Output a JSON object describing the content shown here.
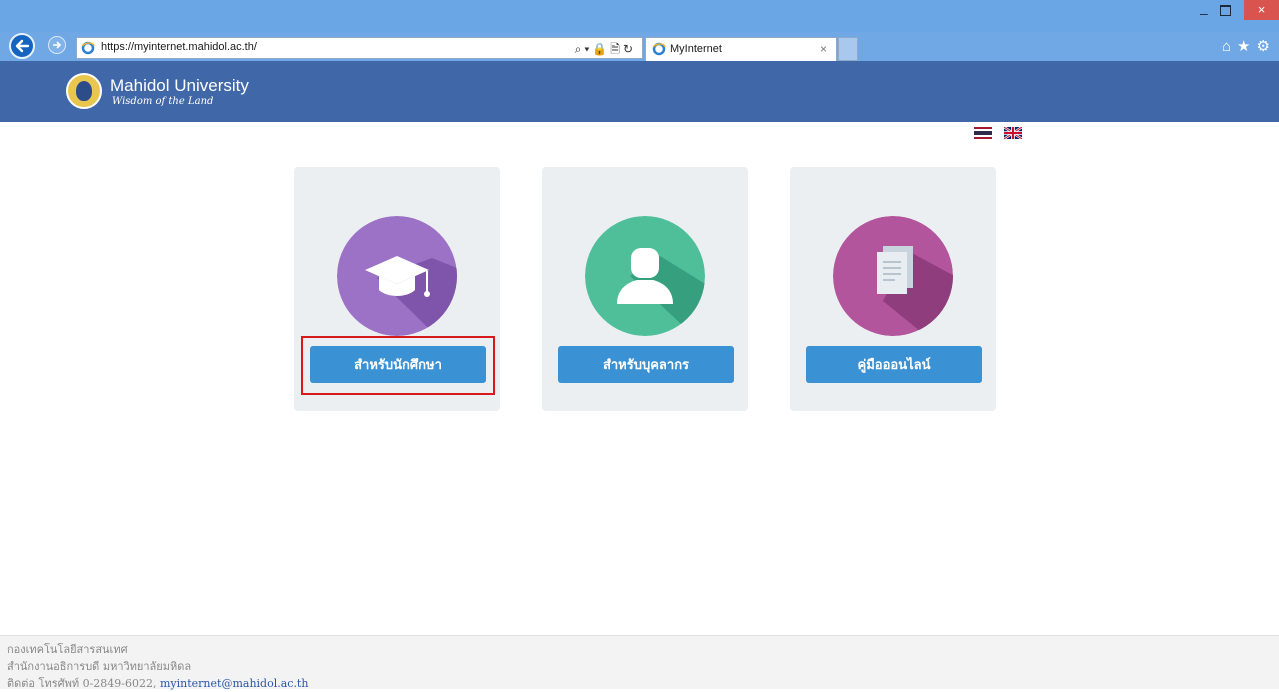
{
  "browser": {
    "url": "https://myinternet.mahidol.ac.th/",
    "tab_title": "MyInternet",
    "tab_close": "×",
    "min_label": "–",
    "close_label": "×",
    "address_tools": "⌕▾🔒🗎↻",
    "right_icons": "⌂★⚙"
  },
  "header": {
    "brand_name": "Mahidol University",
    "brand_tagline": "Wisdom of the Land"
  },
  "cards": [
    {
      "label": "สำหรับนักศึกษา",
      "icon": "graduation-cap-icon",
      "color": "#9b72c6"
    },
    {
      "label": "สำหรับบุคลากร",
      "icon": "person-icon",
      "color": "#4fbf9a"
    },
    {
      "label": "คู่มือออนไลน์",
      "icon": "document-icon",
      "color": "#b3559d"
    }
  ],
  "flags": [
    "thai-flag-icon",
    "uk-flag-icon"
  ],
  "footer": {
    "line1": "กองเทคโนโลยีสารสนเทศ",
    "line2": "สำนักงานอธิการบดี มหาวิทยาลัยมหิดล",
    "line3_prefix": "ติดต่อ โทรศัพท์ 0-2849-6022, ",
    "email": "myinternet@mahidol.ac.th"
  },
  "colors": {
    "header_bg": "#4068a8",
    "button_bg": "#3a92d4",
    "highlight": "#d7191c"
  }
}
